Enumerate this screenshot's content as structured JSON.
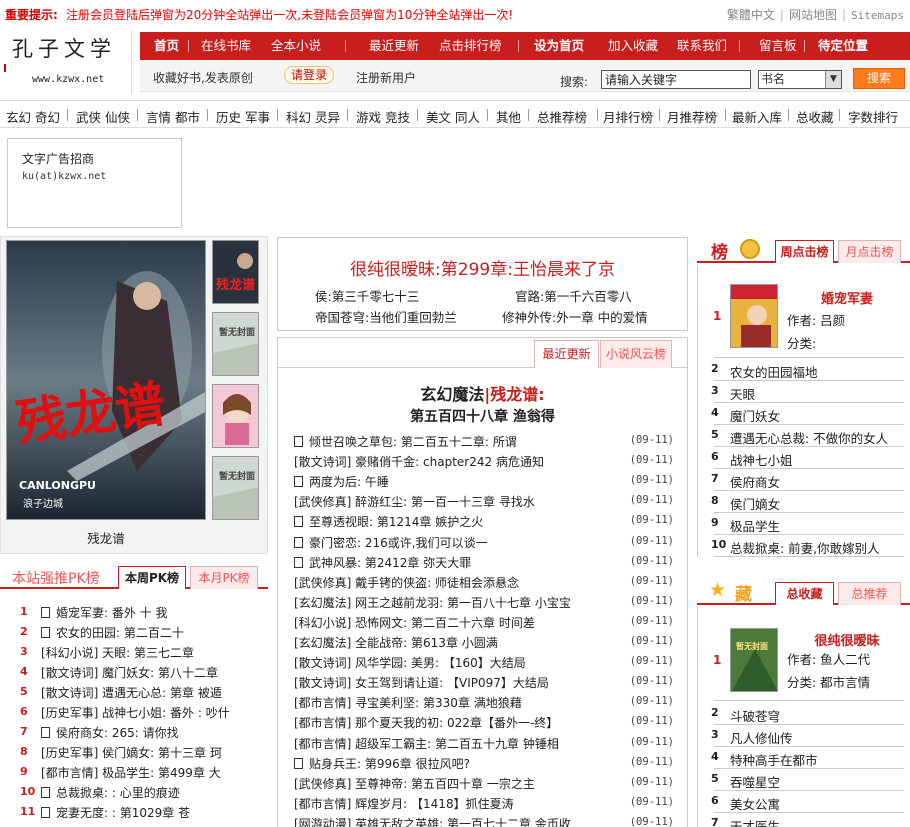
{
  "notice": {
    "prefix": "重要提示:",
    "message": "注册会员登陆后弹窗为20分钟全站弹出一次,未登陆会员弹窗为10分钟全站弹出一次!",
    "links": [
      "繁體中文",
      "网站地图",
      "Sitemaps"
    ]
  },
  "logo": {
    "title": "孔子文学",
    "url": "www.kzwx.net"
  },
  "nav": [
    "首页",
    "在线书库",
    "全本小说",
    "最近更新",
    "点击排行榜",
    "设为首页",
    "加入收藏",
    "联系我们",
    "留言板",
    "待定位置"
  ],
  "subnav": {
    "slogan": "收藏好书,发表原创",
    "login": "请登录",
    "register": "注册新用户",
    "search_label": "搜索:",
    "search_placeholder": "请输入关键字",
    "search_select": "书名",
    "search_button": "搜索"
  },
  "categories": [
    "玄幻 奇幻",
    "武侠 仙侠",
    "言情 都市",
    "历史 军事",
    "科幻 灵异",
    "游戏 竞技",
    "美文 同人",
    "其他",
    "总推荐榜",
    "月排行榜",
    "月推荐榜",
    "最新入库",
    "总收藏",
    "字数排行"
  ],
  "ad": {
    "line1": "文字广告招商",
    "line2": "ku(at)kzwx.net"
  },
  "featured": {
    "title": "残龙谱",
    "cover_title": "残龙谱",
    "cover_sub": "CANLONGPU",
    "cover_author": "浪子边城",
    "thumbs": [
      "残龙谱",
      "暂无封面",
      "",
      "暂无封面"
    ]
  },
  "pk": {
    "title": "本站强推PK榜",
    "tabs": [
      "本周PK榜",
      "本月PK榜"
    ],
    "items": [
      {
        "rank": "1",
        "text": "婚宠军妻: 番外 十 我"
      },
      {
        "rank": "2",
        "text": "农女的田园: 第二百二十"
      },
      {
        "rank": "3",
        "text": "[科幻小说] 天眼: 第三七二章"
      },
      {
        "rank": "4",
        "text": "[散文诗词] 魔门妖女: 第八十二章"
      },
      {
        "rank": "5",
        "text": "[散文诗词] 遭遇无心总: 第章 被遁"
      },
      {
        "rank": "6",
        "text": "[历史军事] 战神七小姐: 番外 : 吵什"
      },
      {
        "rank": "7",
        "text": "侯府商女: 265: 请你找"
      },
      {
        "rank": "8",
        "text": "[历史军事] 侯门嫡女: 第十三章 珂"
      },
      {
        "rank": "9",
        "text": "[都市言情] 极品学生: 第499章 大"
      },
      {
        "rank": "10",
        "text": "总裁掀桌: : 心里的痕迹"
      },
      {
        "rank": "11",
        "text": "宠妻无度: : 第1029章 苍"
      }
    ]
  },
  "headline": {
    "title": "很纯很暧昧:第299章:王怡晨来了京",
    "links": [
      "侯:第三千零七十三",
      "官路:第一千六百零八",
      "帝国苍穹:当他们重回勃兰",
      "修神外传:外一章 中的爱情"
    ]
  },
  "latest": {
    "tabs": [
      "最近更新",
      "小说风云榜"
    ],
    "book_category": "玄幻魔法",
    "book_title": "残龙谱:",
    "chapter": "第五百四十八章 渔翁得",
    "updates": [
      {
        "text": "倾世召唤之草包: 第二百五十二章: 所谓",
        "date": "(09-11)",
        "box": true
      },
      {
        "text": "[散文诗词] 豪赌俏千金: chapter242 病危通知",
        "date": "(09-11)",
        "box": false
      },
      {
        "text": "两度为后: 午睡",
        "date": "(09-11)",
        "box": true
      },
      {
        "text": "[武侠修真] 醉游红尘: 第一百一十三章 寻找水",
        "date": "(09-11)",
        "box": false
      },
      {
        "text": "至尊透视眼: 第1214章 嫉护之火",
        "date": "(09-11)",
        "box": true
      },
      {
        "text": "豪门密恋: 216或许,我们可以谈一",
        "date": "(09-11)",
        "box": true
      },
      {
        "text": "武神风暴: 第2412章 弥天大罪",
        "date": "(09-11)",
        "box": true
      },
      {
        "text": "[武侠修真] 戴手铐的侠盗: 师徒相会添悬念",
        "date": "(09-11)",
        "box": false
      },
      {
        "text": "[玄幻魔法] 网王之越前龙羽: 第一百八十七章 小宝宝",
        "date": "(09-11)",
        "box": false
      },
      {
        "text": "[科幻小说] 恐怖网文: 第二百二十六章 时间差",
        "date": "(09-11)",
        "box": false
      },
      {
        "text": "[玄幻魔法] 全能战帝: 第613章 小圆满",
        "date": "(09-11)",
        "box": false
      },
      {
        "text": "[散文诗词] 风华学园: 美男: 【160】大结局",
        "date": "(09-11)",
        "box": false
      },
      {
        "text": "[散文诗词] 女王驾到请让道: 【VIP097】大结局",
        "date": "(09-11)",
        "box": false
      },
      {
        "text": "[都市言情] 寻宝美利坚: 第330章 满地狼藉",
        "date": "(09-11)",
        "box": false
      },
      {
        "text": "[都市言情] 那个夏天我的初: 022章【番外一-终】",
        "date": "(09-11)",
        "box": false
      },
      {
        "text": "[都市言情] 超级军工霸主: 第二百五十九章 钟锤相",
        "date": "(09-11)",
        "box": false
      },
      {
        "text": "贴身兵王: 第996章 很拉风吧?",
        "date": "(09-11)",
        "box": true
      },
      {
        "text": "[武侠修真] 至尊神帝: 第五百四十章 一宗之主",
        "date": "(09-11)",
        "box": false
      },
      {
        "text": "[都市言情] 辉煌岁月: 【1418】抓住夏涛",
        "date": "(09-11)",
        "box": false
      },
      {
        "text": "[网游动漫] 英雄无敌之英雄: 第一百七十二章 金币收",
        "date": "(09-11)",
        "box": false
      }
    ]
  },
  "rank_box": {
    "title": "榜",
    "tabs": [
      "周点击榜",
      "月点击榜"
    ],
    "top": {
      "rank": "1",
      "title": "婚宠军妻",
      "author": "作者: 吕颜",
      "category": "分类:"
    },
    "items": [
      {
        "rank": "2",
        "text": "农女的田园福地"
      },
      {
        "rank": "3",
        "text": "天眼"
      },
      {
        "rank": "4",
        "text": "魔门妖女"
      },
      {
        "rank": "5",
        "text": "遭遇无心总裁: 不做你的女人"
      },
      {
        "rank": "6",
        "text": "战神七小姐"
      },
      {
        "rank": "7",
        "text": "侯府商女"
      },
      {
        "rank": "8",
        "text": "侯门嫡女"
      },
      {
        "rank": "9",
        "text": "极品学生"
      },
      {
        "rank": "10",
        "text": "总裁掀桌: 前妻,你敢嫁别人"
      }
    ]
  },
  "fav_box": {
    "title": "藏",
    "tabs": [
      "总收藏",
      "总推荐"
    ],
    "top": {
      "rank": "1",
      "title": "很纯很暧昧",
      "author": "作者: 鱼人二代",
      "category": "分类: 都市言情",
      "cover_text": "暂无封面"
    },
    "items": [
      {
        "rank": "2",
        "text": "斗破苍穹"
      },
      {
        "rank": "3",
        "text": "凡人修仙传"
      },
      {
        "rank": "4",
        "text": "特种高手在都市"
      },
      {
        "rank": "5",
        "text": "吞噬星空"
      },
      {
        "rank": "6",
        "text": "美女公寓"
      },
      {
        "rank": "7",
        "text": "天才医生"
      }
    ]
  },
  "colors": {
    "brand": "#c81e1e",
    "accent": "#ff7a1a"
  }
}
